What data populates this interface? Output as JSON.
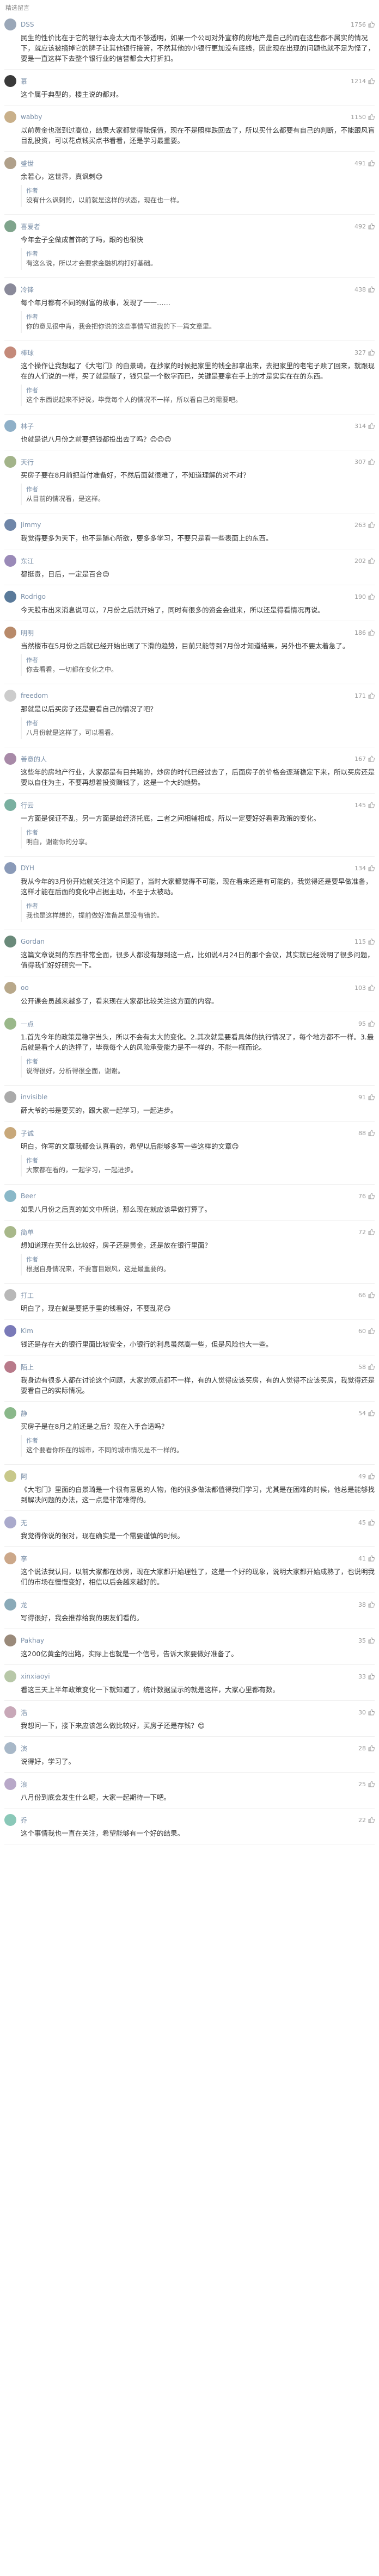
{
  "header": {
    "title": "精选留言"
  },
  "colors": {
    "accent": "#7a8fa8",
    "text": "#333333",
    "muted": "#999999"
  },
  "comments": [
    {
      "name": "DSS",
      "likes": "1756",
      "avatar_color": "#9aa7b8",
      "text": "民生的性价比在于它的银行本身太大而不够透明，如果一个公司对外宣称的房地产是自己的而在这些都不属实的情况下，就应该被摘掉它的牌子让其他银行接管，不然其他的小银行更加没有底线，因此现在出现的问题也就不足为怪了，要是一直这样下去整个银行业的信誉都会大打折扣。",
      "replies": []
    },
    {
      "name": "慕",
      "likes": "1214",
      "avatar_color": "#3a3a3a",
      "text": "这个属于典型的，楼主说的都对。",
      "replies": []
    },
    {
      "name": "wabby",
      "likes": "1150",
      "avatar_color": "#c9b08a",
      "text": "以前黄金也涨到过高位，结果大家都觉得能保值，现在不是照样跌回去了，所以买什么都要有自己的判断，不能跟风盲目乱投资，可以花点钱买点书看看，还是学习最重要。",
      "replies": []
    },
    {
      "name": "盛世",
      "likes": "491",
      "avatar_color": "#b0a08a",
      "text": "余若心，这世界，真讽刺😊",
      "replies": [
        {
          "name": "作者",
          "text": "没有什么讽刺的，以前就是这样的状态，现在也一样。"
        }
      ]
    },
    {
      "name": "喜爱者",
      "likes": "492",
      "avatar_color": "#7fa48c",
      "text": "今年金子全做成首饰的了吗，跟的也很快",
      "replies": [
        {
          "name": "作者",
          "text": "有这么说，所以才会要求金融机构打好基础。"
        }
      ]
    },
    {
      "name": "冷锋",
      "likes": "438",
      "avatar_color": "#8a8a9a",
      "text": "每个年月都有不同的财富的故事，发现了一一……",
      "replies": [
        {
          "name": "作者",
          "text": "你的意见很中肯，我会把你说的这些事情写进我的下一篇文章里。"
        }
      ]
    },
    {
      "name": "棒球",
      "likes": "327",
      "avatar_color": "#c48a7a",
      "text": "这个操作让我想起了《大宅门》的白景琦，在抄家的时候把家里的钱全部拿出来，去把家里的老宅子赎了回来，就跟现在的人们说的一样，买了就是赚了，钱只是一个数字而已，关键是要拿在手上的才是实实在在的东西。",
      "replies": [
        {
          "name": "作者",
          "text": "这个东西说起来不好说，毕竟每个人的情况不一样，所以看自己的需要吧。"
        }
      ]
    },
    {
      "name": "林子",
      "likes": "314",
      "avatar_color": "#8fb0c8",
      "text": "也就是说八月份之前要把钱都投出去了吗？😊😊😊",
      "replies": []
    },
    {
      "name": "天行",
      "likes": "307",
      "avatar_color": "#a3b48a",
      "text": "买房子要在8月前把首付准备好，不然后面就很难了，不知道理解的对不对？",
      "replies": [
        {
          "name": "作者",
          "text": "从目前的情况看，是这样。"
        }
      ]
    },
    {
      "name": "Jimmy",
      "likes": "263",
      "avatar_color": "#6f86a8",
      "text": "我觉得要多为天下，也不是随心所欲，要多多学习，不要只是看一些表面上的东西。",
      "replies": []
    },
    {
      "name": "东江",
      "likes": "202",
      "avatar_color": "#9a8ab8",
      "text": "都挺贵，日后，一定是百合😊",
      "replies": []
    },
    {
      "name": "Rodrigo",
      "likes": "190",
      "avatar_color": "#5a7a9a",
      "text": "今天股市出来消息说可以，7月份之后就开始了，同时有很多的资金会进来，所以还是得看情况再说。",
      "replies": []
    },
    {
      "name": "明明",
      "likes": "186",
      "avatar_color": "#b88a6a",
      "text": "当然楼市在5月份之后就已经开始出现了下滑的趋势，目前只能等到7月份才知道结果，另外也不要太着急了。",
      "replies": [
        {
          "name": "作者",
          "text": "你去看看，一切都在变化之中。"
        }
      ]
    },
    {
      "name": "freedom",
      "likes": "171",
      "avatar_color": "#cccccc",
      "text": "那就是以后买房子还是要看自己的情况了吧？",
      "replies": [
        {
          "name": "作者",
          "text": "八月份就是这样了，可以看看。"
        }
      ]
    },
    {
      "name": "善意的人",
      "likes": "167",
      "avatar_color": "#a88aa8",
      "text": "这些年的房地产行业，大家都是有目共睹的，炒房的时代已经过去了，后面房子的价格会逐渐稳定下来，所以买房还是要以自住为主，不要再想着投资赚钱了，这是一个大的趋势。",
      "replies": []
    },
    {
      "name": "行云",
      "likes": "145",
      "avatar_color": "#7ab0a0",
      "text": "一方面是保证不乱，另一方面是给经济托底，二者之间相辅相成，所以一定要好好看看政策的变化。",
      "replies": [
        {
          "name": "作者",
          "text": "明白，谢谢你的分享。"
        }
      ]
    },
    {
      "name": "DYH",
      "likes": "134",
      "avatar_color": "#8a9ab8",
      "text": "我从今年的3月份开始就关注这个问题了，当时大家都觉得不可能，现在看来还是有可能的，我觉得还是要早做准备，这样才能在后面的变化中占据主动，不至于太被动。",
      "replies": [
        {
          "name": "作者",
          "text": "我也是这样想的，提前做好准备总是没有错的。"
        }
      ]
    },
    {
      "name": "Gordan",
      "likes": "115",
      "avatar_color": "#6a8a7a",
      "text": "这篇文章说到的东西非常全面，很多人都没有想到这一点，比如说4月24日的那个会议，其实就已经说明了很多问题，值得我们好好研究一下。",
      "replies": []
    },
    {
      "name": "oo",
      "likes": "103",
      "avatar_color": "#b8a88a",
      "text": "公开课会员越来越多了，看来现在大家都比较关注这方面的内容。",
      "replies": []
    },
    {
      "name": "一点",
      "likes": "95",
      "avatar_color": "#9ab88a",
      "text": "1.首先今年的政策是稳字当头，所以不会有太大的变化。2.其次就是要看具体的执行情况了，每个地方都不一样。3.最后就是看个人的选择了，毕竟每个人的风险承受能力是不一样的，不能一概而论。",
      "replies": [
        {
          "name": "作者",
          "text": "说得很好，分析得很全面，谢谢。"
        }
      ]
    },
    {
      "name": "invisible",
      "likes": "91",
      "avatar_color": "#aaaaaa",
      "text": "薛大爷的书是要买的，跟大家一起学习，一起进步。",
      "replies": []
    },
    {
      "name": "子诚",
      "likes": "88",
      "avatar_color": "#c8a87a",
      "text": "明白，你写的文章我都会认真看的，希望以后能够多写一些这样的文章😊",
      "replies": [
        {
          "name": "作者",
          "text": "大家都在看的，一起学习，一起进步。"
        }
      ]
    },
    {
      "name": "Beer",
      "likes": "76",
      "avatar_color": "#8ab8c8",
      "text": "如果八月份之后真的如文中所说，那么现在就应该早做打算了。",
      "replies": []
    },
    {
      "name": "简单",
      "likes": "72",
      "avatar_color": "#a8b88a",
      "text": "想知道现在买什么比较好，房子还是黄金，还是放在银行里面？",
      "replies": [
        {
          "name": "作者",
          "text": "根据自身情况来，不要盲目跟风，这是最重要的。"
        }
      ]
    },
    {
      "name": "打工",
      "likes": "66",
      "avatar_color": "#b8b8b8",
      "text": "明白了，现在就是要把手里的钱看好，不要乱花😊",
      "replies": []
    },
    {
      "name": "Kim",
      "likes": "60",
      "avatar_color": "#7a7ab8",
      "text": "钱还是存在大的银行里面比较安全，小银行的利息虽然高一些，但是风险也大一些。",
      "replies": []
    },
    {
      "name": "陌上",
      "likes": "58",
      "avatar_color": "#b87a8a",
      "text": "我身边有很多人都在讨论这个问题，大家的观点都不一样，有的人觉得应该买房，有的人觉得不应该买房，我觉得还是要看自己的实际情况。",
      "replies": []
    },
    {
      "name": "静",
      "likes": "54",
      "avatar_color": "#8ab88a",
      "text": "买房子是在8月之前还是之后？现在入手合适吗？",
      "replies": [
        {
          "name": "作者",
          "text": "这个要看你所在的城市，不同的城市情况是不一样的。"
        }
      ]
    },
    {
      "name": "阿",
      "likes": "49",
      "avatar_color": "#c8c88a",
      "text": "《大宅门》里面的白景琦是一个很有意思的人物，他的很多做法都值得我们学习，尤其是在困难的时候，他总是能够找到解决问题的办法，这一点是非常难得的。",
      "replies": []
    },
    {
      "name": "无",
      "likes": "45",
      "avatar_color": "#aaaacc",
      "text": "我觉得你说的很对，现在确实是一个需要谨慎的时候。",
      "replies": []
    },
    {
      "name": "李",
      "likes": "41",
      "avatar_color": "#cca88a",
      "text": "这个说法我认同，以前大家都在炒房，现在大家都开始理性了，这是一个好的现象，说明大家都开始成熟了，也说明我们的市场在慢慢变好，相信以后会越来越好的。",
      "replies": []
    },
    {
      "name": "龙",
      "likes": "38",
      "avatar_color": "#8aaab8",
      "text": "写得很好，我会推荐给我的朋友们看的。",
      "replies": []
    },
    {
      "name": "Pakhay",
      "likes": "35",
      "avatar_color": "#9a8a7a",
      "text": "这200亿黄金的出路，实际上也就是一个信号，告诉大家要做好准备了。",
      "replies": []
    },
    {
      "name": "xinxiaoyi",
      "likes": "33",
      "avatar_color": "#b8c8a8",
      "text": "看这三天上半年政策变化一下就知道了，统计数据显示的就是这样，大家心里都有数。",
      "replies": []
    },
    {
      "name": "浩",
      "likes": "30",
      "avatar_color": "#c8a8b8",
      "text": "我想问一下，接下来应该怎么做比较好，买房子还是存钱？😊",
      "replies": []
    },
    {
      "name": "演",
      "likes": "28",
      "avatar_color": "#a8b8c8",
      "text": "说得好，学习了。",
      "replies": []
    },
    {
      "name": "浪",
      "likes": "25",
      "avatar_color": "#b8a8c8",
      "text": "八月份到底会发生什么呢，大家一起期待一下吧。",
      "replies": []
    },
    {
      "name": "乔",
      "likes": "22",
      "avatar_color": "#8ac8b8",
      "text": "这个事情我也一直在关注，希望能够有一个好的结果。",
      "replies": []
    }
  ]
}
